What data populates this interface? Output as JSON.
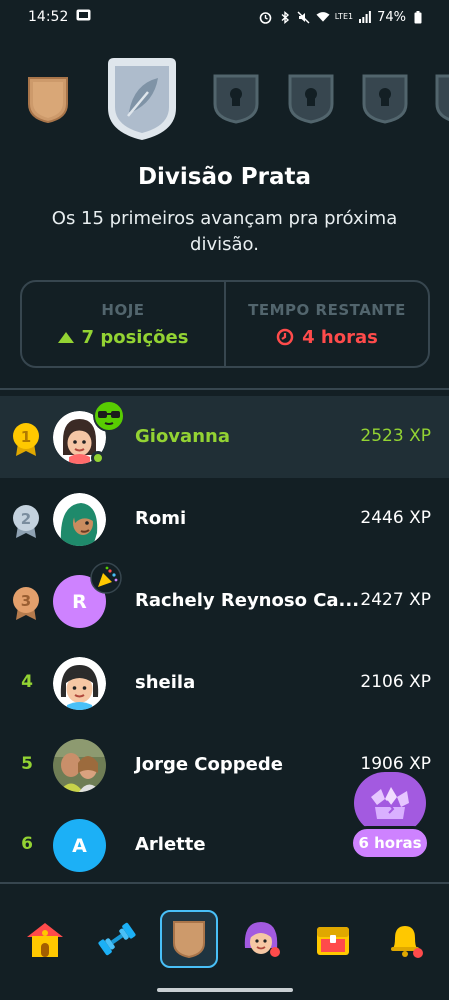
{
  "status_bar": {
    "time": "14:52",
    "battery": "74%",
    "network": "LTE1",
    "icons": [
      "alarm-icon",
      "bluetooth-icon",
      "mute-icon",
      "wifi-icon",
      "signal-icon",
      "battery-icon"
    ]
  },
  "leagues": [
    {
      "name": "bronze",
      "state": "completed",
      "color": "#cd9a6b"
    },
    {
      "name": "silver",
      "state": "current",
      "color": "#b6c6d3"
    },
    {
      "name": "locked-1",
      "state": "locked",
      "color": "#37464f"
    },
    {
      "name": "locked-2",
      "state": "locked",
      "color": "#37464f"
    },
    {
      "name": "locked-3",
      "state": "locked",
      "color": "#37464f"
    },
    {
      "name": "locked-4",
      "state": "locked",
      "color": "#37464f"
    }
  ],
  "division": {
    "title": "Divisão Prata",
    "subtitle": "Os 15 primeiros avançam pra próxima divisão."
  },
  "stats": {
    "today_label": "HOJE",
    "today_value": "7 posições",
    "remaining_label": "TEMPO RESTANTE",
    "remaining_value": "4 horas"
  },
  "leaderboard": [
    {
      "rank": "1",
      "name": "Giovanna",
      "xp": "2523 XP",
      "is_you": true,
      "avatar_letter": ""
    },
    {
      "rank": "2",
      "name": "Romi",
      "xp": "2446 XP",
      "is_you": false,
      "avatar_letter": ""
    },
    {
      "rank": "3",
      "name": "Rachely Reynoso Ca...",
      "xp": "2427 XP",
      "is_you": false,
      "avatar_letter": "R"
    },
    {
      "rank": "4",
      "name": "sheila",
      "xp": "2106 XP",
      "is_you": false,
      "avatar_letter": ""
    },
    {
      "rank": "5",
      "name": "Jorge Coppede",
      "xp": "1906 XP",
      "is_you": false,
      "avatar_letter": ""
    },
    {
      "rank": "6",
      "name": "Arlette",
      "xp": "",
      "is_you": false,
      "avatar_letter": "A"
    }
  ],
  "chest_timer": "6 horas",
  "nav": [
    {
      "name": "home",
      "icon": "home-icon",
      "active": false
    },
    {
      "name": "practice",
      "icon": "dumbbell-icon",
      "active": false
    },
    {
      "name": "leagues",
      "icon": "shield-icon",
      "active": true
    },
    {
      "name": "profile",
      "icon": "profile-icon",
      "active": false
    },
    {
      "name": "shop",
      "icon": "chest-icon",
      "active": false
    },
    {
      "name": "notifications",
      "icon": "bell-icon",
      "active": false
    }
  ],
  "colors": {
    "background": "#131f24",
    "green": "#93d333",
    "red": "#ff4b4b",
    "border": "#37464f",
    "purple": "#ce82ff",
    "blue": "#49c0f8"
  }
}
